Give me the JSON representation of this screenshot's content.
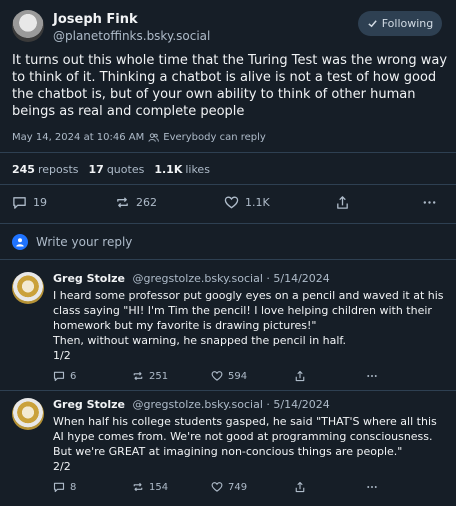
{
  "post": {
    "author_name": "Joseph Fink",
    "author_handle": "@planetoffinks.bsky.social",
    "follow_label": "Following",
    "text": "It turns out this whole time that the Turing Test was the wrong way to think of it. Thinking a chatbot is alive is not a test of how good the chatbot is, but of your own ability to think of other human beings as real and complete people",
    "timestamp": "May 14, 2024 at 10:46 AM",
    "audience": "Everybody can reply",
    "reposts_count": "245",
    "reposts_label": "reposts",
    "quotes_count": "17",
    "quotes_label": "quotes",
    "likes_count": "1.1K",
    "likes_label": "likes",
    "reply_count": "19",
    "repost_count": "262",
    "like_count": "1.1K"
  },
  "reply_prompt": "Write your reply",
  "replies": [
    {
      "name": "Greg Stolze",
      "handle": "@gregstolze.bsky.social",
      "date": "· 5/14/2024",
      "text": "I heard some professor put googly eyes on a pencil and waved it at his class saying \"HI! I'm Tim the pencil! I love helping children with their homework but my favorite is drawing pictures!\"\nThen, without warning, he snapped the pencil in half.\n1/2",
      "replies": "6",
      "reposts": "251",
      "likes": "594"
    },
    {
      "name": "Greg Stolze",
      "handle": "@gregstolze.bsky.social",
      "date": "· 5/14/2024",
      "text": "When half his college students gasped, he said \"THAT'S where all this AI hype comes from. We're not good at programming consciousness. But we're GREAT at imagining non-concious things are people.\"\n2/2",
      "replies": "8",
      "reposts": "154",
      "likes": "749"
    }
  ],
  "icons": {
    "reply": "speech-bubble-icon",
    "repost": "repost-arrows-icon",
    "like": "heart-icon",
    "share": "share-icon",
    "more": "ellipsis-icon",
    "follow": "checkmark-icon",
    "audience": "people-icon",
    "reply_avatar": "person-icon"
  },
  "colors": {
    "background": "#161e27",
    "border": "#2e4052",
    "text_primary": "#f1f3f5",
    "text_secondary": "#aebbc9",
    "accent": "#1f73ff"
  }
}
